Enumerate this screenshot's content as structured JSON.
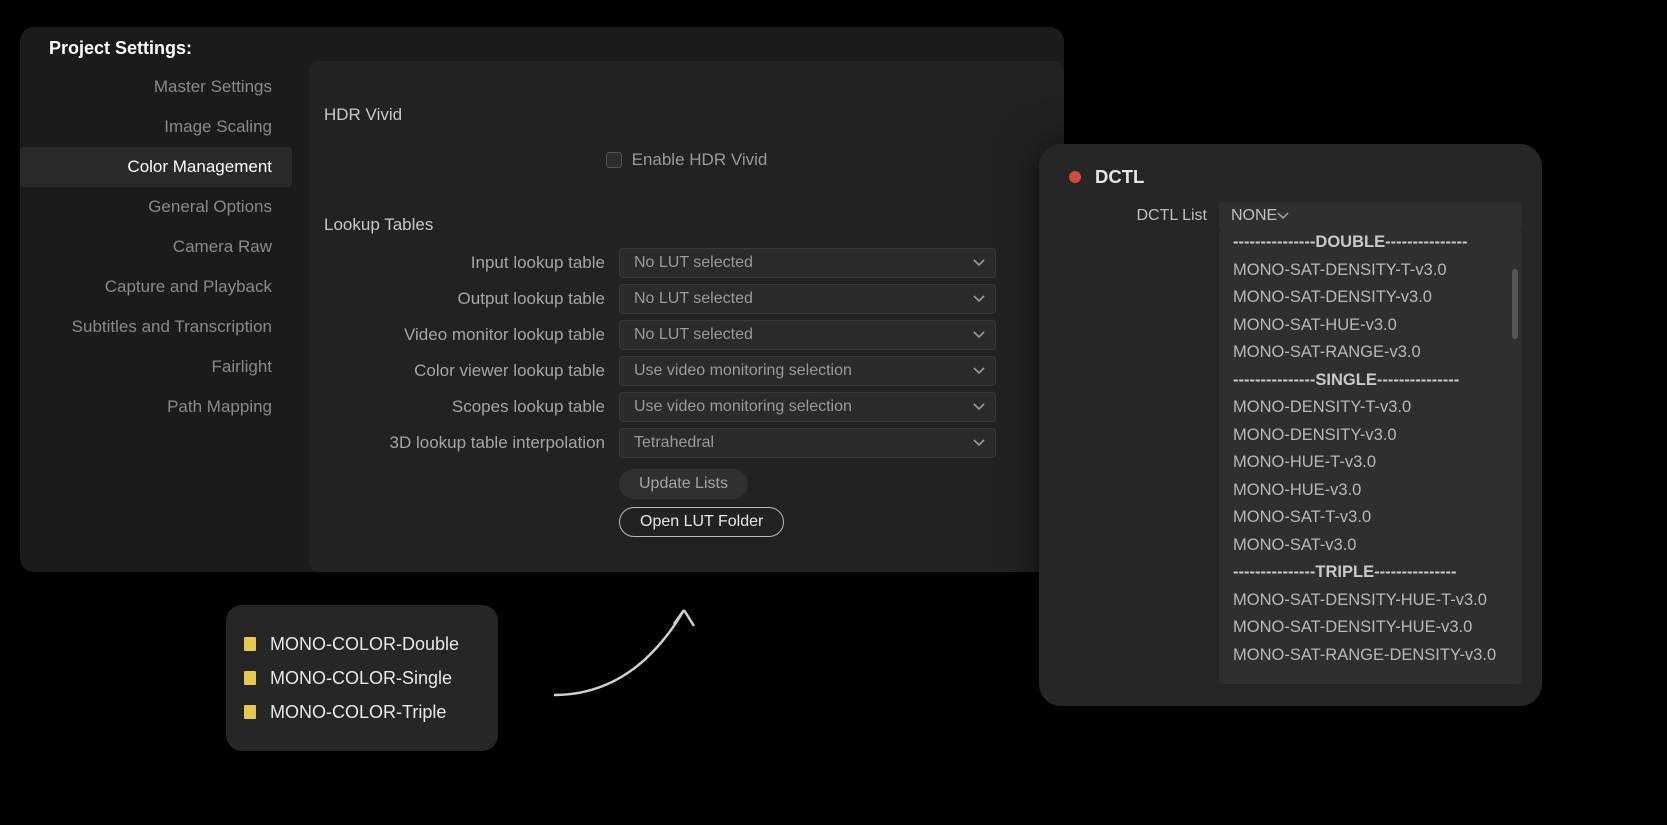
{
  "ps": {
    "title": "Project Settings:",
    "sidebar": [
      "Master Settings",
      "Image Scaling",
      "Color Management",
      "General Options",
      "Camera Raw",
      "Capture and Playback",
      "Subtitles and Transcription",
      "Fairlight",
      "Path Mapping"
    ],
    "sidebar_active_index": 2,
    "hdr": {
      "section": "HDR Vivid",
      "enable_label": "Enable HDR Vivid"
    },
    "lut": {
      "section": "Lookup Tables",
      "rows": [
        {
          "label": "Input lookup table",
          "value": "No LUT selected"
        },
        {
          "label": "Output lookup table",
          "value": "No LUT selected"
        },
        {
          "label": "Video monitor lookup table",
          "value": "No LUT selected"
        },
        {
          "label": "Color viewer lookup table",
          "value": "Use video monitoring selection"
        },
        {
          "label": "Scopes lookup table",
          "value": "Use video monitoring selection"
        },
        {
          "label": "3D lookup table interpolation",
          "value": "Tetrahedral"
        }
      ],
      "update_btn": "Update Lists",
      "open_btn": "Open LUT Folder"
    }
  },
  "folders": [
    "MONO-COLOR-Double",
    "MONO-COLOR-Single",
    "MONO-COLOR-Triple"
  ],
  "dctl": {
    "title": "DCTL",
    "list_label": "DCTL List",
    "selected": "NONE",
    "items": [
      {
        "text": "---------------DOUBLE---------------",
        "sep": true
      },
      {
        "text": "MONO-SAT-DENSITY-T-v3.0"
      },
      {
        "text": "MONO-SAT-DENSITY-v3.0"
      },
      {
        "text": "MONO-SAT-HUE-v3.0"
      },
      {
        "text": "MONO-SAT-RANGE-v3.0"
      },
      {
        "text": "---------------SINGLE---------------",
        "sep": true
      },
      {
        "text": "MONO-DENSITY-T-v3.0"
      },
      {
        "text": "MONO-DENSITY-v3.0"
      },
      {
        "text": "MONO-HUE-T-v3.0"
      },
      {
        "text": "MONO-HUE-v3.0"
      },
      {
        "text": "MONO-SAT-T-v3.0"
      },
      {
        "text": "MONO-SAT-v3.0"
      },
      {
        "text": "---------------TRIPLE---------------",
        "sep": true
      },
      {
        "text": "MONO-SAT-DENSITY-HUE-T-v3.0"
      },
      {
        "text": "MONO-SAT-DENSITY-HUE-v3.0"
      },
      {
        "text": "MONO-SAT-RANGE-DENSITY-v3.0"
      }
    ]
  }
}
